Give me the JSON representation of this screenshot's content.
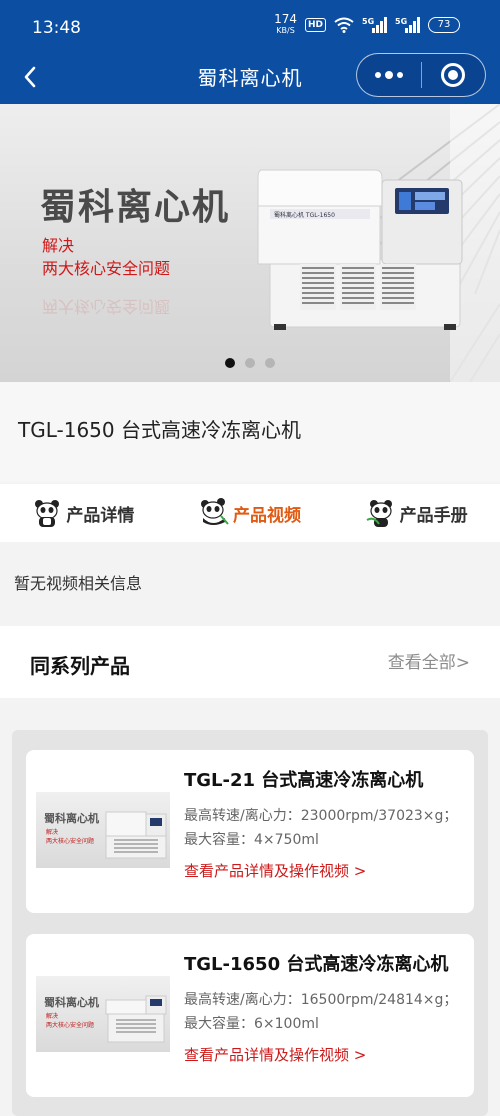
{
  "status_bar": {
    "time": "13:48",
    "speed_value": "174",
    "speed_unit": "KB/S",
    "hd_badge": "HD",
    "network_1": "5G",
    "network_2": "5G",
    "battery": "73"
  },
  "nav": {
    "title": "蜀科离心机"
  },
  "banner": {
    "brand": "蜀科离心机",
    "line1": "解决",
    "line2": "两大核心安全问题",
    "machine_label": "蜀科离心机 TGL-1650",
    "slide_count": 3,
    "active_slide": 1
  },
  "product": {
    "title": "TGL-1650 台式高速冷冻离心机"
  },
  "tabs": [
    {
      "label": "产品详情",
      "active": false
    },
    {
      "label": "产品视频",
      "active": true
    },
    {
      "label": "产品手册",
      "active": false
    }
  ],
  "video_notice": "暂无视频相关信息",
  "series": {
    "title": "同系列产品",
    "see_all": "查看全部>",
    "items": [
      {
        "name": "TGL-21 台式高速冷冻离心机",
        "spec": "最高转速/离心力：23000rpm/37023×g；最大容量：4×750ml",
        "link": "查看产品详情及操作视频 >",
        "thumb_brand": "蜀科离心机",
        "thumb_line1": "解决",
        "thumb_line2": "两大核心安全问题"
      },
      {
        "name": "TGL-1650 台式高速冷冻离心机",
        "spec": "最高转速/离心力：16500rpm/24814×g；最大容量：6×100ml",
        "link": "查看产品详情及操作视频 >",
        "thumb_brand": "蜀科离心机",
        "thumb_line1": "解决",
        "thumb_line2": "两大核心安全问题"
      }
    ]
  },
  "colors": {
    "nav_bg": "#0b4ea2",
    "active_tab": "#e05a12",
    "link_red": "#cc1a1a",
    "banner_red": "#d01818"
  }
}
